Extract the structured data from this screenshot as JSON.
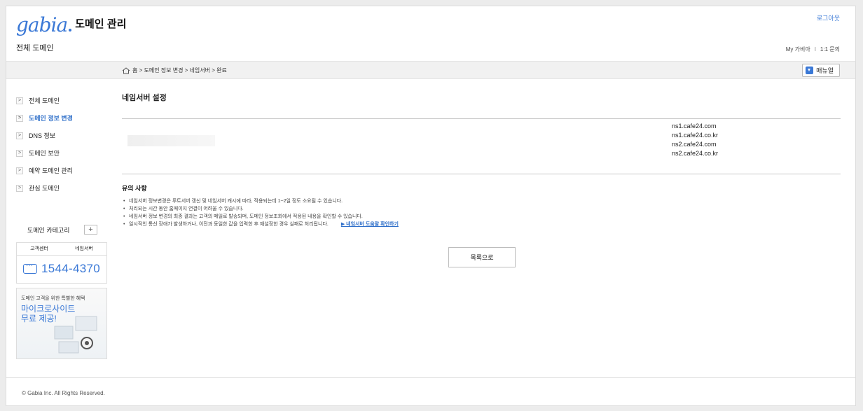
{
  "header": {
    "logo_text": "gabia",
    "title": "도메인 관리",
    "subtitle": "전체 도메인",
    "logout": "로그아웃",
    "links": [
      "My 가비아",
      "1:1 문의"
    ]
  },
  "breadcrumb": {
    "path": "홈 > 도메인 정보 변경 > 네임서버 > 완료",
    "manual_label": "매뉴얼"
  },
  "sidebar": {
    "items": [
      {
        "label": "전체 도메인",
        "active": false
      },
      {
        "label": "도메인 정보 변경",
        "active": true
      },
      {
        "label": "DNS 정보",
        "active": false
      },
      {
        "label": "도메인 보안",
        "active": false
      },
      {
        "label": "예약 도메인 관리",
        "active": false
      },
      {
        "label": "관심 도메인",
        "active": false
      }
    ],
    "category_label": "도메인 카테고리",
    "category_add": "+",
    "support_tabs": [
      "고객센터",
      "네임서버"
    ],
    "phone": "1544-4370",
    "promo_small": "도메인 고객을 위한 특별한 혜택",
    "promo_big": [
      "마이크로사이트",
      "무료 제공!"
    ]
  },
  "main": {
    "title": "네임서버 설정",
    "nameservers": [
      "ns1.cafe24.com",
      "ns1.cafe24.co.kr",
      "ns2.cafe24.com",
      "ns2.cafe24.co.kr"
    ],
    "notes_title": "유의 사항",
    "notes": [
      "네임서버 정보변경은 루트서버 갱신 및 네임서버 캐시에 따라, 적용되는데 1~2일 정도 소요될 수 있습니다.",
      "처리되는 시간 동안 홈페이지 연결이 어려울 수 있습니다.",
      "네임서버 정보 변경의 최종 결과는 고객의 메일로 발송되며, 도메인 정보조회에서 적용된 내용을 확인할 수 있습니다.",
      "일시적인 통신 장애가 발생하거나, 이전과 동일한 값을 입력한 후 재설정한 경우 실패로 처리됩니다."
    ],
    "help_link": "▶ 네임서버 도움말 확인하기",
    "list_button": "목록으로"
  },
  "footer": {
    "copyright": "© Gabia Inc. All Rights Reserved."
  },
  "colors": {
    "accent": "#3a78d6",
    "active_nav": "#2f6fc9"
  }
}
